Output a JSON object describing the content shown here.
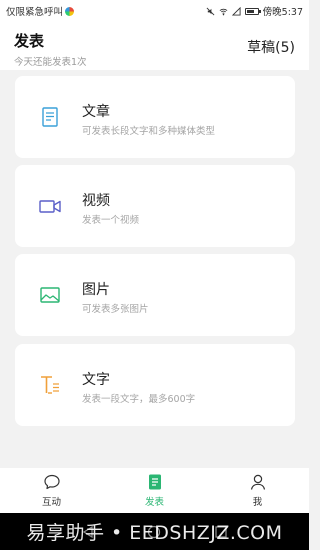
{
  "status": {
    "carrier": "仅限紧急呼叫",
    "time": "傍晚5:37"
  },
  "header": {
    "title": "发表",
    "subtitle": "今天还能发表1次",
    "drafts": "草稿(5)"
  },
  "cards": [
    {
      "title": "文章",
      "desc": "可发表长段文字和多种媒体类型",
      "icon": "article-icon",
      "color": "#3aa0d8"
    },
    {
      "title": "视频",
      "desc": "发表一个视频",
      "icon": "video-icon",
      "color": "#5a5fc8"
    },
    {
      "title": "图片",
      "desc": "可发表多张图片",
      "icon": "image-icon",
      "color": "#2bb673"
    },
    {
      "title": "文字",
      "desc": "发表一段文字，最多600字",
      "icon": "text-icon",
      "color": "#f0a03a"
    }
  ],
  "tabs": [
    {
      "label": "互动",
      "icon": "chat-icon"
    },
    {
      "label": "发表",
      "icon": "publish-icon",
      "active": true
    },
    {
      "label": "我",
      "icon": "profile-icon"
    }
  ],
  "watermark": "易享助手 • EEDSHZJZ.COM"
}
